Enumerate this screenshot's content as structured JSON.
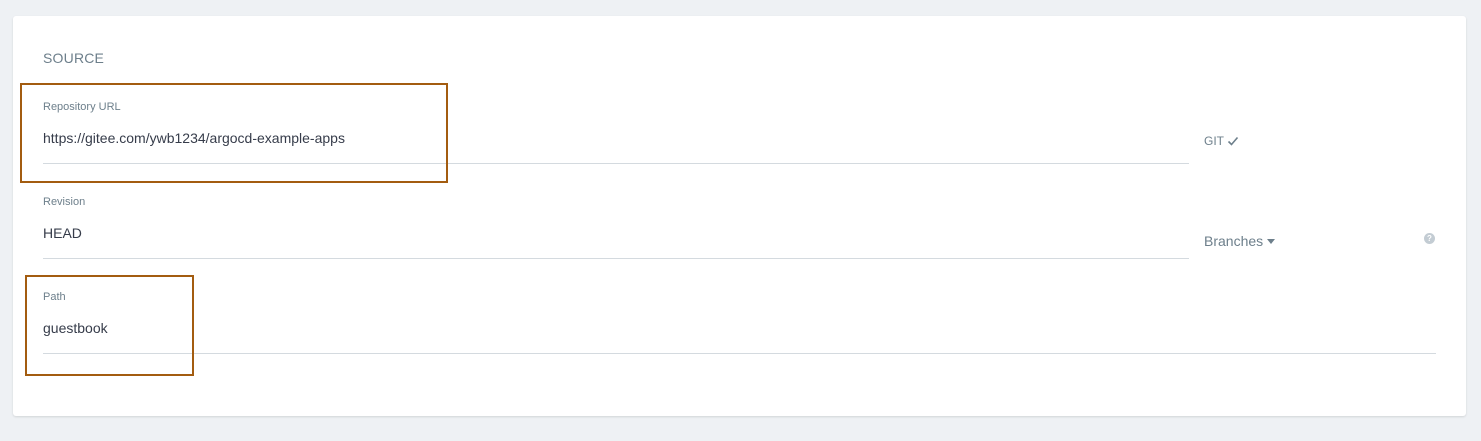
{
  "section": {
    "title": "SOURCE"
  },
  "repository": {
    "label": "Repository URL",
    "value": "https://gitee.com/ywb1234/argocd-example-apps",
    "type_badge": "GIT"
  },
  "revision": {
    "label": "Revision",
    "value": "HEAD",
    "dropdown_label": "Branches"
  },
  "path": {
    "label": "Path",
    "value": "guestbook"
  },
  "icons": {
    "type_check": "check-icon",
    "dropdown": "caret-down-icon",
    "help": "help-icon"
  },
  "colors": {
    "background": "#eef1f4",
    "card": "#ffffff",
    "label": "#6d7f8b",
    "text": "#363c4a",
    "underline": "#d4dadf",
    "highlight_border": "#a35c10"
  }
}
